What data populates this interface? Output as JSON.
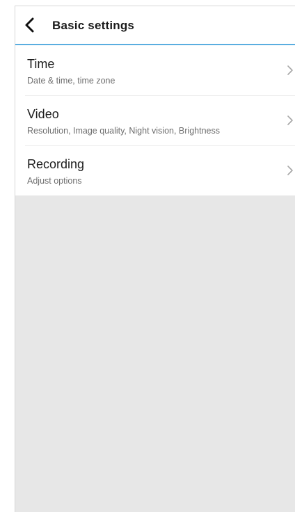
{
  "header": {
    "back_icon": "chevron-left-icon",
    "title": "Basic settings"
  },
  "settings": {
    "items": [
      {
        "title": "Time",
        "subtitle": "Date & time, time zone",
        "icon": "chevron-right-icon"
      },
      {
        "title": "Video",
        "subtitle": "Resolution, Image quality, Night vision, Brightness",
        "icon": "chevron-right-icon"
      },
      {
        "title": "Recording",
        "subtitle": "Adjust options",
        "icon": "chevron-right-icon"
      }
    ]
  },
  "colors": {
    "accent": "#5aaee0",
    "background": "#e7e7e7",
    "surface": "#ffffff"
  }
}
